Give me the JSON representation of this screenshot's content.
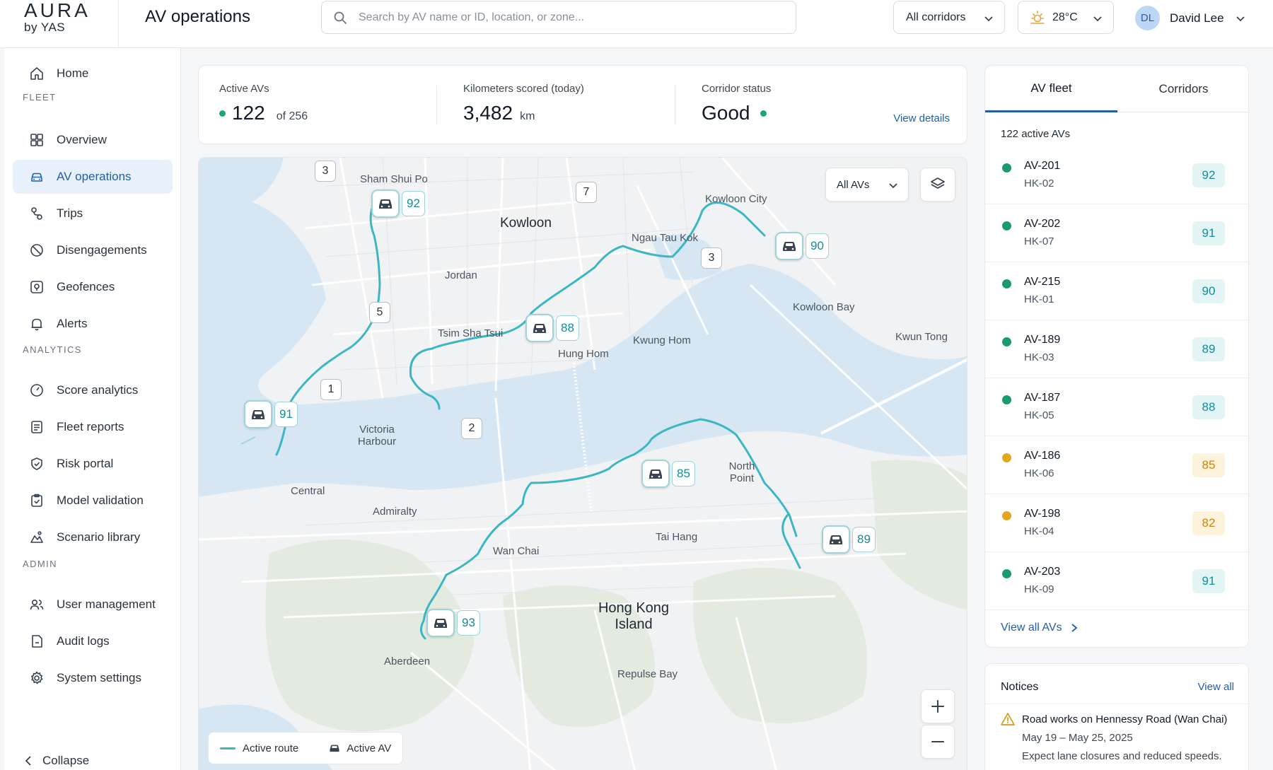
{
  "brand": {
    "name": "AURA",
    "sub": "by YAS"
  },
  "header": {
    "title": "AV operations",
    "search_placeholder": "Search by AV name or ID, location, or zone...",
    "corridor_filter": "All corridors",
    "weather": "28°C",
    "user_initials": "DL",
    "user_name": "David Lee"
  },
  "sidebar": {
    "home": "Home",
    "sections": {
      "fleet": "FLEET",
      "analytics": "ANALYTICS",
      "admin": "ADMIN"
    },
    "fleet_items": [
      "Overview",
      "AV operations",
      "Trips",
      "Disengagements",
      "Geofences",
      "Alerts"
    ],
    "analytics_items": [
      "Score analytics",
      "Fleet reports",
      "Risk portal",
      "Model validation",
      "Scenario library"
    ],
    "admin_items": [
      "User management",
      "Audit logs",
      "System settings"
    ],
    "collapse": "Collapse",
    "active": "AV operations"
  },
  "stats": {
    "active_label": "Active AVs",
    "active_value": "122",
    "active_total": "of 256",
    "km_label": "Kilometers scored (today)",
    "km_value": "3,482",
    "km_unit": "km",
    "corridor_label": "Corridor status",
    "corridor_value": "Good",
    "view_details": "View details"
  },
  "map": {
    "filter": "All AVs",
    "labels": {
      "sham_shui_po": "Sham Shui Po",
      "kowloon": "Kowloon",
      "kowloon_city": "Kowloon City",
      "ngau_tau_kok": "Ngau Tau Kok",
      "jordan": "Jordan",
      "kowloon_bay": "Kowloon Bay",
      "kwun_tong": "Kwun Tong",
      "tsim_sha_tsui": "Tsim Sha Tsui",
      "kwung_hom": "Kwung Hom",
      "hung_hom": "Hung Hom",
      "victoria_harbour": "Victoria Harbour",
      "north_point": "North Point",
      "central": "Central",
      "admiralty": "Admiralty",
      "tai_hang": "Tai Hang",
      "wan_chai": "Wan Chai",
      "hk_island": "Hong Kong Island",
      "aberdeen": "Aberdeen",
      "repulse_bay": "Repulse Bay"
    },
    "markers": [
      "92",
      "90",
      "88",
      "91",
      "85",
      "89",
      "93"
    ],
    "waypoints": [
      "3",
      "7",
      "3",
      "5",
      "1",
      "2"
    ],
    "legend_route": "Active route",
    "legend_av": "Active AV",
    "route_color": "#3cb6c3"
  },
  "panel": {
    "tabs": [
      "AV fleet",
      "Corridors"
    ],
    "count": "122 active AVs",
    "avs": [
      {
        "id": "AV-201",
        "zone": "HK-02",
        "score": "92",
        "status": "good"
      },
      {
        "id": "AV-202",
        "zone": "HK-07",
        "score": "91",
        "status": "good"
      },
      {
        "id": "AV-215",
        "zone": "HK-01",
        "score": "90",
        "status": "good"
      },
      {
        "id": "AV-189",
        "zone": "HK-03",
        "score": "89",
        "status": "good"
      },
      {
        "id": "AV-187",
        "zone": "HK-05",
        "score": "88",
        "status": "good"
      },
      {
        "id": "AV-186",
        "zone": "HK-06",
        "score": "85",
        "status": "warn"
      },
      {
        "id": "AV-198",
        "zone": "HK-04",
        "score": "82",
        "status": "warn"
      },
      {
        "id": "AV-203",
        "zone": "HK-09",
        "score": "91",
        "status": "good"
      }
    ],
    "view_all": "View all AVs",
    "colors": {
      "good": "#1a9c6a",
      "warn": "#e2a81b"
    }
  },
  "notices": {
    "title": "Notices",
    "view_all": "View all",
    "item_title": "Road works on Hennessy Road (Wan Chai)",
    "item_date": "May 19 – May 25, 2025",
    "item_desc": "Expect lane closures and reduced speeds."
  }
}
